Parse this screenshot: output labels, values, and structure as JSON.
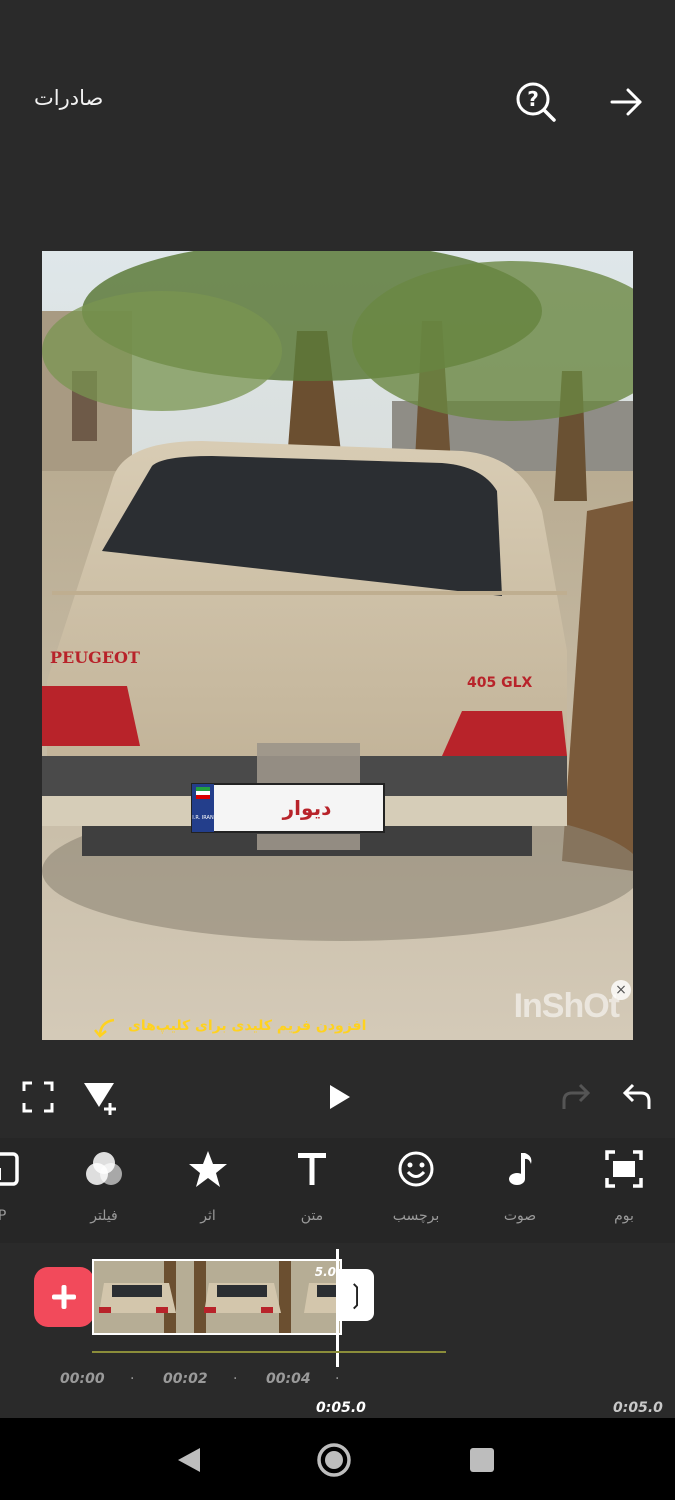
{
  "header": {
    "export_label": "صادرات",
    "help_icon": "help-search-icon",
    "forward_icon": "arrow-right-icon"
  },
  "preview": {
    "watermark": "InShOt",
    "keyframe_hint": "افزودن فریم کلیدی برای کلیپ‌های",
    "plate_text": "دیوار",
    "plate_country": "I.R. IRAN",
    "car_badge_left": "PEUGEOT",
    "car_badge_right": "405 GLX"
  },
  "controls": {
    "fullscreen_icon": "fullscreen-icon",
    "keyframe_icon": "keyframe-add-icon",
    "play_icon": "play-icon",
    "redo_icon": "redo-icon",
    "undo_icon": "undo-icon"
  },
  "toolbar": {
    "items": [
      {
        "label": "IP",
        "icon": "pip-icon"
      },
      {
        "label": "فیلتر",
        "icon": "filter-icon"
      },
      {
        "label": "اثر",
        "icon": "star-icon"
      },
      {
        "label": "متن",
        "icon": "text-icon"
      },
      {
        "label": "برچسب",
        "icon": "sticker-icon"
      },
      {
        "label": "صوت",
        "icon": "music-icon"
      },
      {
        "label": "بوم",
        "icon": "canvas-icon"
      }
    ]
  },
  "timeline": {
    "clip_duration": "5.0",
    "ticks": [
      "00:00",
      "00:02",
      "00:04"
    ],
    "current_time": "0:05.0",
    "total_time": "0:05.0"
  },
  "colors": {
    "background": "#2a2a2a",
    "accent_add": "#f24a5b",
    "hint_yellow": "#ffd21f"
  }
}
